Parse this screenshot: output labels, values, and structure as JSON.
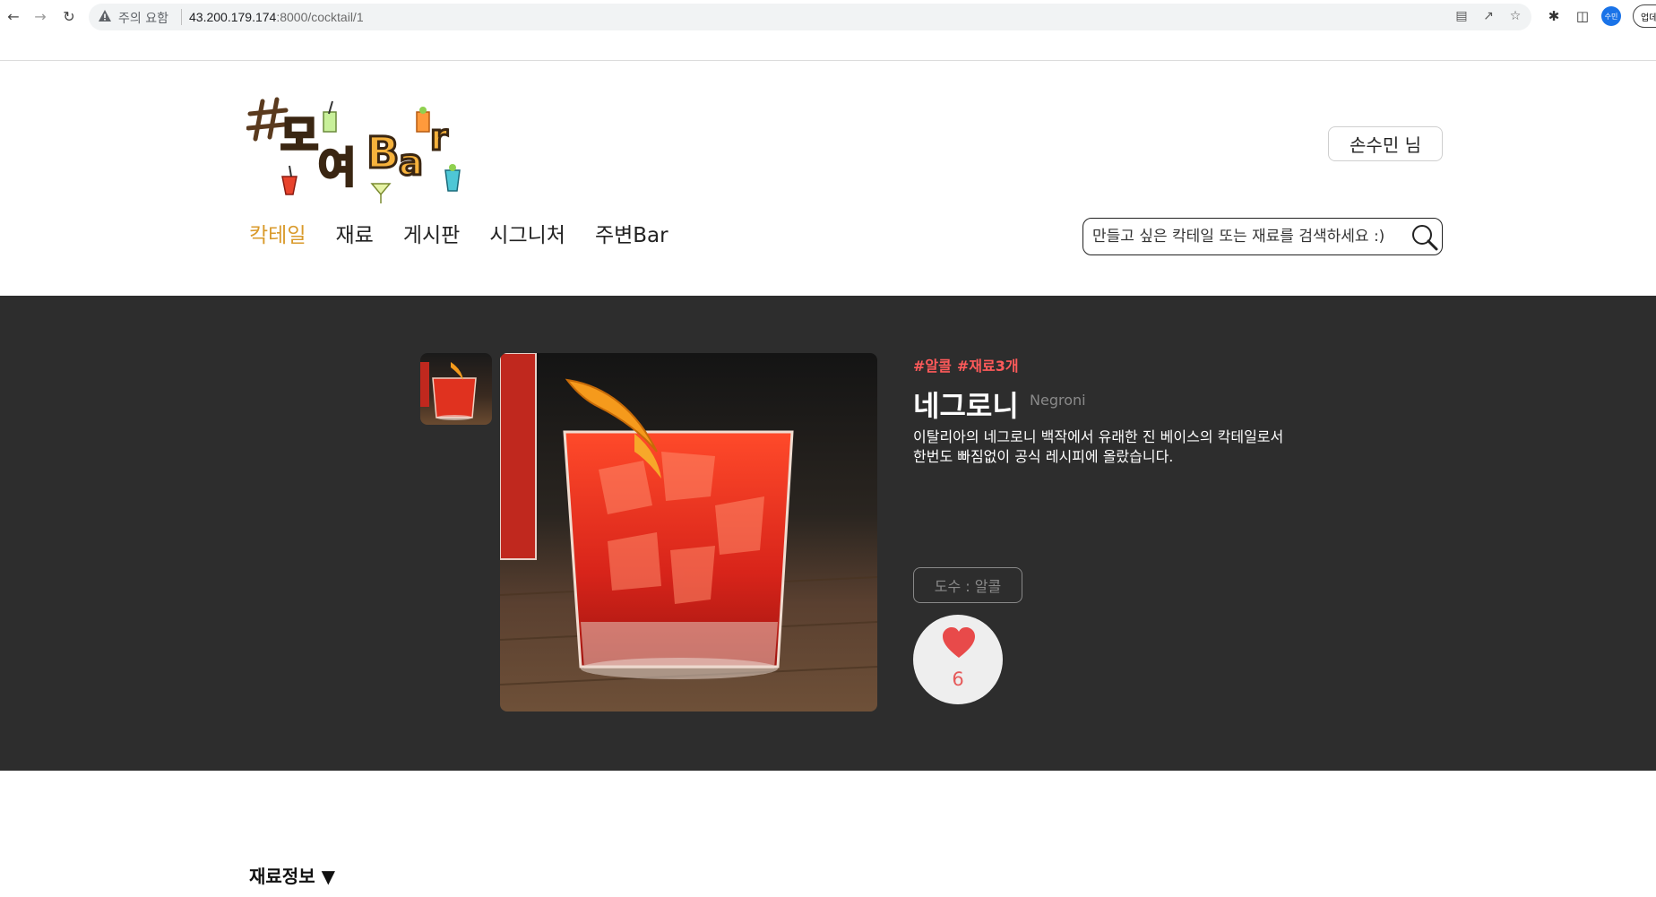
{
  "browser": {
    "security_warning": "주의 요함",
    "url_host": "43.200.179.174",
    "url_rest": ":8000/cocktail/1",
    "profile_label": "수민",
    "update_label": "업데"
  },
  "header": {
    "logo_alt": "#모여Bar",
    "user_button": "손수민 님",
    "menu": [
      {
        "label": "칵테일",
        "active": true
      },
      {
        "label": "재료",
        "active": false
      },
      {
        "label": "게시판",
        "active": false
      },
      {
        "label": "시그니처",
        "active": false
      },
      {
        "label": "주변Bar",
        "active": false
      }
    ],
    "search_placeholder": "만들고 싶은 칵테일 또는 재료를 검색하세요 :)"
  },
  "cocktail": {
    "tags": [
      "#알콜",
      "#재료3개"
    ],
    "name": "네그로니",
    "name_en": "Negroni",
    "description": "이탈리아의 네그로니 백작에서 유래한 진 베이스의 칵테일로서 한번도 빠짐없이 공식 레시피에 올랐습니다.",
    "abv_label": "도수 : 알콜",
    "likes": "6"
  },
  "sections": {
    "ingredients_title": "재료정보 ▼"
  },
  "colors": {
    "accent": "#d99a2b",
    "tag": "#ff5a5a",
    "hero_bg": "#2d2d2d",
    "heart": "#e84a4a"
  }
}
